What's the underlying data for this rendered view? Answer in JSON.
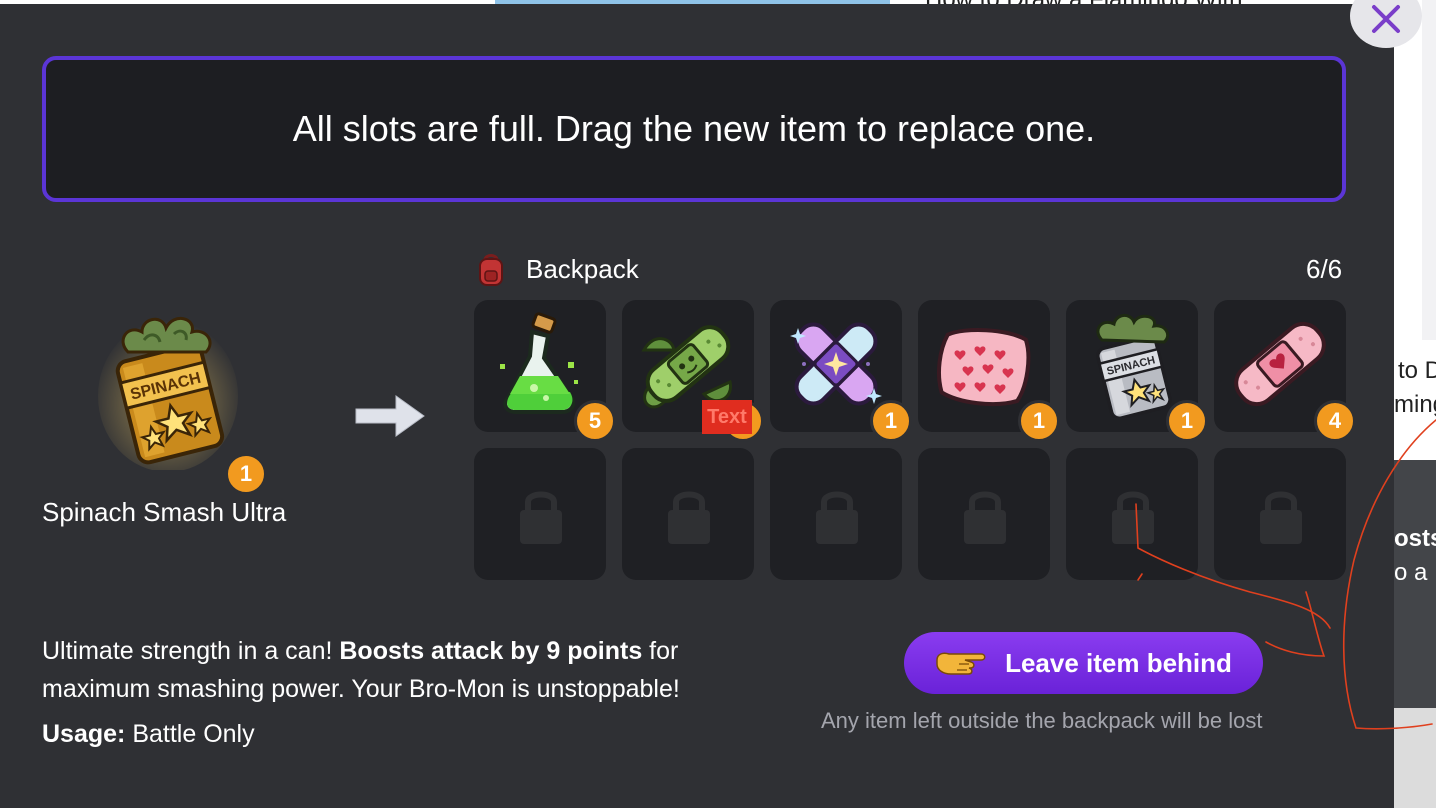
{
  "background_page": {
    "title_fragment": "How to Draw a Flamingo With",
    "right_card_line1": "to D",
    "right_card_line2": "mingo",
    "dark_card_line1": "osts",
    "dark_card_line2": "o a"
  },
  "modal": {
    "banner_text": "All slots are full. Drag the new item to replace one.",
    "new_item": {
      "name": "Spinach Smash Ultra",
      "count": "1",
      "icon": "spinach-can-gold-icon"
    },
    "backpack": {
      "title": "Backpack",
      "count": "6/6",
      "icon": "backpack-icon",
      "slots": [
        {
          "icon": "green-potion-flask-icon",
          "count": "5"
        },
        {
          "icon": "leaf-bandage-icon",
          "count": ""
        },
        {
          "icon": "sparkle-cross-bandage-icon",
          "count": "1"
        },
        {
          "icon": "heart-pillow-icon",
          "count": "1"
        },
        {
          "icon": "spinach-can-silver-icon",
          "count": "1"
        },
        {
          "icon": "heart-bandage-icon",
          "count": "4"
        }
      ],
      "locked_slots": 6,
      "debug_tag": "Text"
    },
    "description": {
      "text_start": "Ultimate strength in a can! ",
      "text_bold": "Boosts attack by 9 points",
      "text_end": " for maximum smashing power. Your Bro-Mon is unstoppable!",
      "usage_label": "Usage:",
      "usage_value": " Battle Only"
    },
    "leave_button": {
      "label": "Leave item behind",
      "icon": "pointing-hand-icon"
    },
    "leave_note": "Any item left outside the backpack will be lost",
    "colors": {
      "modal_bg": "#2f3034",
      "banner_border": "#5b35d6",
      "badge": "#f29a1f",
      "button_purple": "#7a2fe6",
      "annotation_red": "#e0401e"
    }
  }
}
